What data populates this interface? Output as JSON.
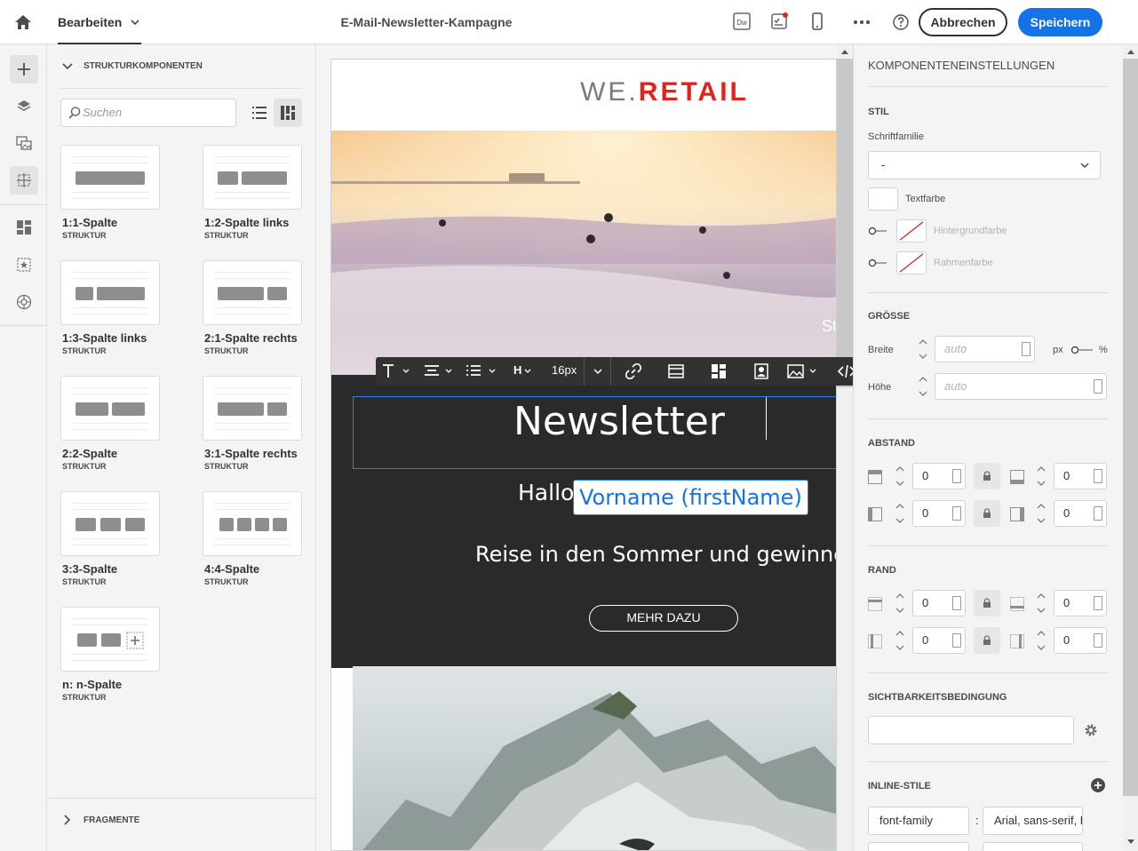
{
  "topbar": {
    "mode_label": "Bearbeiten",
    "title": "E-Mail-Newsletter-Kampagne",
    "cancel_label": "Abbrechen",
    "save_label": "Speichern",
    "dw_badge": "Dw",
    "accent": "#1473e6"
  },
  "rail": {
    "items": [
      "add-icon",
      "layers-icon",
      "assets-icon",
      "structure-icon",
      "fragments-icon",
      "content-components-icon",
      "personalization-icon"
    ]
  },
  "left_panel": {
    "header": "STRUKTURKOMPONENTEN",
    "search_placeholder": "Suchen",
    "components": [
      {
        "name": "1:1-Spalte",
        "type": "STRUKTUR"
      },
      {
        "name": "1:2-Spalte links",
        "type": "STRUKTUR"
      },
      {
        "name": "1:3-Spalte links",
        "type": "STRUKTUR"
      },
      {
        "name": "2:1-Spalte rechts",
        "type": "STRUKTUR"
      },
      {
        "name": "2:2-Spalte",
        "type": "STRUKTUR"
      },
      {
        "name": "3:1-Spalte rechts",
        "type": "STRUKTUR"
      },
      {
        "name": "3:3-Spalte",
        "type": "STRUKTUR"
      },
      {
        "name": "4:4-Spalte",
        "type": "STRUKTUR"
      },
      {
        "name": "n: n-Spalte",
        "type": "STRUKTUR"
      }
    ],
    "fragments_label": "FRAGMENTE"
  },
  "email": {
    "logo_part1": "WE.",
    "logo_part2": "RETAIL",
    "hero_fragment": "St",
    "headline": "Newsletter",
    "greeting": "Hallo",
    "personalization": "Vorname (firstName)",
    "body_text": "Reise in den Sommer und gewinne",
    "button_label": "MEHR DAZU",
    "brand_color": "#e2231a"
  },
  "toolbar": {
    "heading_label": "H",
    "font_size": "16px"
  },
  "right_panel": {
    "title": "KOMPONENTENEINSTELLUNGEN",
    "style_section": "STIL",
    "font_family_label": "Schriftfamilie",
    "font_family_value": "-",
    "text_color_label": "Textfarbe",
    "bg_color_label": "Hintergrundfarbe",
    "border_color_label": "Rahmenfarbe",
    "size_section": "GRÖSSE",
    "width_label": "Breite",
    "height_label": "Höhe",
    "auto_placeholder": "auto",
    "unit_px": "px",
    "unit_pct": "%",
    "spacing_section": "ABSTAND",
    "border_section": "RAND",
    "zero": "0",
    "visibility_section": "SICHTBARKEITSBEDINGUNG",
    "inline_styles_section": "INLINE-STILE",
    "inline_prop": "font-family",
    "inline_sep": ":",
    "inline_value": "Arial, sans-serif, La"
  }
}
